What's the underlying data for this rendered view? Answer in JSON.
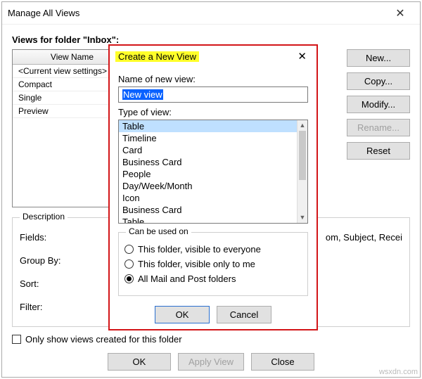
{
  "parent": {
    "title": "Manage All Views",
    "views_for": "Views for folder \"Inbox\":",
    "header_col1": "View Name",
    "rows": [
      "<Current view settings>",
      "Compact",
      "Single",
      "Preview"
    ],
    "buttons": {
      "new": "New...",
      "copy": "Copy...",
      "modify": "Modify...",
      "rename": "Rename...",
      "reset": "Reset"
    },
    "description": {
      "legend": "Description",
      "fields_label": "Fields:",
      "fields_value": "om, Subject, Recei",
      "groupby_label": "Group By:",
      "sort_label": "Sort:",
      "filter_label": "Filter:"
    },
    "only_show": "Only show views created for this folder",
    "bottom": {
      "ok": "OK",
      "apply": "Apply View",
      "close": "Close"
    }
  },
  "modal": {
    "title": "Create a New View",
    "name_label": "Name of new view:",
    "name_value": "New view",
    "type_label": "Type of view:",
    "type_items": [
      "Table",
      "Timeline",
      "Card",
      "Business Card",
      "People",
      "Day/Week/Month",
      "Icon",
      "Business Card",
      "Table"
    ],
    "selected_type_index": 0,
    "can_legend": "Can be used on",
    "radios": {
      "r1": "This folder, visible to everyone",
      "r2": "This folder, visible only to me",
      "r3": "All Mail and Post folders"
    },
    "selected_radio": 2,
    "ok": "OK",
    "cancel": "Cancel"
  },
  "watermark": "wsxdn.com"
}
